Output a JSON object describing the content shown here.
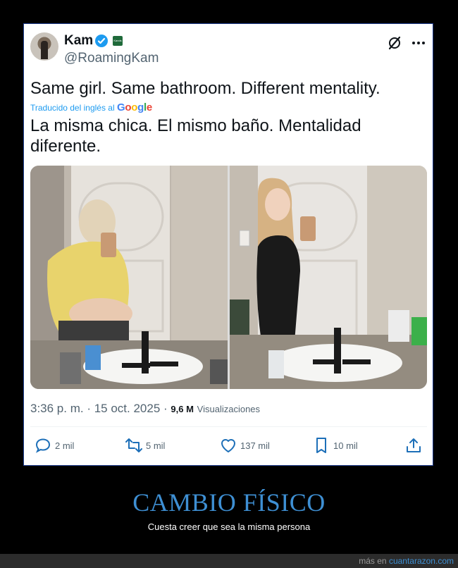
{
  "tweet": {
    "display_name": "Kam",
    "affiliate_badge": "Kands",
    "handle": "@RoamingKam",
    "original_text": "Same girl. Same bathroom. Different mentality.",
    "translation_note": "Traducido del inglés al",
    "translation_provider": "Google",
    "translated_text": "La misma chica. El mismo baño. Mentalidad diferente.",
    "timestamp": "3:36 p. m. · 15 oct. 2025 ·",
    "views_count": "9,6 M",
    "views_label": "Visualizaciones",
    "actions": {
      "reply_count": "2 mil",
      "retweet_count": "5 mil",
      "like_count": "137 mil",
      "bookmark_count": "10 mil"
    }
  },
  "caption": {
    "headline": "CAMBIO FÍSICO",
    "subheadline": "Cuesta creer que sea la misma persona"
  },
  "footer": {
    "prefix": "más en",
    "site": "cuantarazon.com"
  },
  "colors": {
    "accent": "#1d9bf0",
    "headline": "#3e8fd3",
    "background": "#000000"
  },
  "icons": [
    "verified-icon",
    "x-logo-icon",
    "more-icon",
    "reply-icon",
    "retweet-icon",
    "like-icon",
    "bookmark-icon",
    "share-icon"
  ]
}
